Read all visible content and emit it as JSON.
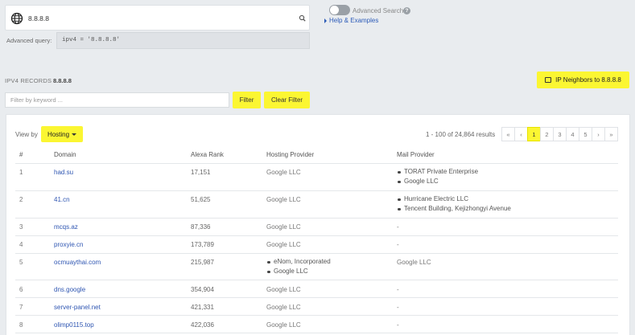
{
  "search": {
    "value": "8.8.8.8"
  },
  "advanced": {
    "label": "Advanced query:",
    "query": "ipv4 = '8.8.8.8'",
    "toggle_label": "Advanced Search",
    "help_q": "?",
    "help_link": "Help & Examples"
  },
  "records": {
    "label": "IPV4 RECORDS",
    "value": "8.8.8.8"
  },
  "neighbors_button": "IP Neighbors to 8.8.8.8",
  "filter": {
    "placeholder": "Filter by keyword ...",
    "button": "Filter",
    "clear": "Clear Filter"
  },
  "view": {
    "label": "View by",
    "selected": "Hosting"
  },
  "results": {
    "text": "1 - 100 of 24,864 results"
  },
  "pager": {
    "first": "«",
    "prev": "‹",
    "pages": [
      "1",
      "2",
      "3",
      "4",
      "5"
    ],
    "next": "›",
    "last": "»",
    "active": "1"
  },
  "table": {
    "headers": [
      "#",
      "Domain",
      "Alexa Rank",
      "Hosting Provider",
      "Mail Provider"
    ],
    "rows": [
      {
        "num": "1",
        "domain": "had.su",
        "rank": "17,151",
        "hosting": [
          "Google LLC"
        ],
        "mail": [
          "TORAT Private Enterprise",
          "Google LLC"
        ]
      },
      {
        "num": "2",
        "domain": "41.cn",
        "rank": "51,625",
        "hosting": [
          "Google LLC"
        ],
        "mail": [
          "Hurricane Electric LLC",
          "Tencent Building, Kejizhongyi Avenue"
        ]
      },
      {
        "num": "3",
        "domain": "mcqs.az",
        "rank": "87,336",
        "hosting": [
          "Google LLC"
        ],
        "mail": [
          "-"
        ]
      },
      {
        "num": "4",
        "domain": "proxyie.cn",
        "rank": "173,789",
        "hosting": [
          "Google LLC"
        ],
        "mail": [
          "-"
        ]
      },
      {
        "num": "5",
        "domain": "ocmuaythai.com",
        "rank": "215,987",
        "hosting": [
          "eNom, Incorporated",
          "Google LLC"
        ],
        "mail": [
          "Google LLC"
        ]
      },
      {
        "num": "6",
        "domain": "dns.google",
        "rank": "354,904",
        "hosting": [
          "Google LLC"
        ],
        "mail": [
          "-"
        ]
      },
      {
        "num": "7",
        "domain": "server-panel.net",
        "rank": "421,331",
        "hosting": [
          "Google LLC"
        ],
        "mail": [
          "-"
        ]
      },
      {
        "num": "8",
        "domain": "olimp0115.top",
        "rank": "422,036",
        "hosting": [
          "Google LLC"
        ],
        "mail": [
          "-"
        ]
      }
    ]
  },
  "colors": {
    "accent": "#fbf632",
    "link": "#2f56b2",
    "background": "#e9ecef"
  }
}
